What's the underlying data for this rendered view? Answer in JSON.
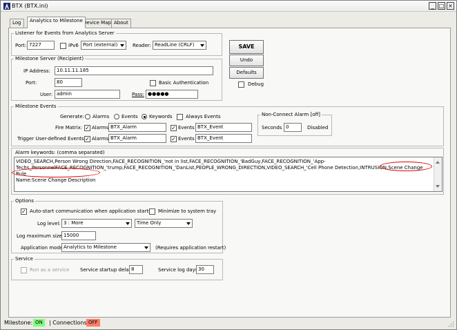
{
  "window": {
    "title": "BTX (BTX.ini)",
    "minimize": "_",
    "maximize": "□",
    "close": "×"
  },
  "tabs": [
    {
      "label": "Log"
    },
    {
      "label": "Analytics to Milestone"
    },
    {
      "label": "Device Map"
    },
    {
      "label": "About"
    }
  ],
  "listener": {
    "legend": "Listener for Events from Analytics Server",
    "port_label": "Port:",
    "port_value": "7227",
    "ipv6_label": "IPv6",
    "port_type": "Port (external)",
    "reader_label": "Reader:",
    "reader_value": "ReadLine (CRLF)"
  },
  "milestone_server": {
    "legend": "Milestone Server (Recipient)",
    "ip_label": "IP Address:",
    "ip_value": "10.11.11.185",
    "port_label": "Port:",
    "port_value": "80",
    "basic_auth_label": "Basic Authentication",
    "user_label": "User:",
    "user_value": "admin",
    "pass_label": "Pass:",
    "pass_value": "●●●●●"
  },
  "actions": {
    "save": "SAVE",
    "undo": "Undo",
    "defaults": "Defaults",
    "debug": "Debug"
  },
  "milestone_events": {
    "legend": "Milestone Events",
    "generate_label": "Generate:",
    "opt_alarms": "Alarms",
    "opt_events": "Events",
    "opt_keywords": "Keywords",
    "always_events": "Always Events",
    "fire_matrix_label": "Fire Matrix:",
    "trigger_label": "Trigger User-defined Events:",
    "alarms_label": "Alarms",
    "events_label": "Events",
    "fire_alarm_value": "BTX_Alarm",
    "fire_event_value": "BTX_Event",
    "trigger_alarm_value": "BTX_Alarm",
    "trigger_event_value": "BTX_Event",
    "nonconnect_legend": "Non-Connect Alarm [off]",
    "seconds_label": "Seconds",
    "seconds_value": "0",
    "disabled_label": "Disabled"
  },
  "alarm_keywords": {
    "label": "Alarm keywords:   (comma separated)",
    "line1": "VIDEO_SEARCH,Person Wrong Direction,FACE_RECOGNITION_'not in list,FACE_RECOGNITION_'BadGuy,FACE_RECOGNITION_'App-",
    "line2": "Techs_PersonnelFACE_RECOGNITION_'trump,FACE_RECOGNITION_'DanList,PEOPLE_WRONG_DIRECTION,VIDEO_SEARCH_'Cell Phone Detection,INTRUSION,Scene Change Rule",
    "line3": "Name:Scene Change Description"
  },
  "options": {
    "legend": "Options",
    "autostart_label": "Auto-start communication when application starts",
    "minimize_label": "Minimize to system tray",
    "log_level_label": "Log level:",
    "log_level_value": "3 : More",
    "time_value": "Time Only",
    "log_max_label": "Log maximum size:",
    "log_max_value": "15000",
    "app_mode_label": "Application mode:",
    "app_mode_value": "Analytics to Milestone",
    "restart_note": "(Requires application restart)"
  },
  "service": {
    "legend": "Service",
    "run_as_service": "Run as a service",
    "startup_delay_label": "Service startup delay",
    "startup_delay_value": "8",
    "log_days_label": "Service log days:",
    "log_days_value": "30"
  },
  "status": {
    "milestone_label": "Milestone:",
    "milestone_value": "ON",
    "connections_label": "| Connections:",
    "connections_value": "OFF",
    "on_color": "#7cff7c",
    "off_color": "#ff7c6a"
  }
}
